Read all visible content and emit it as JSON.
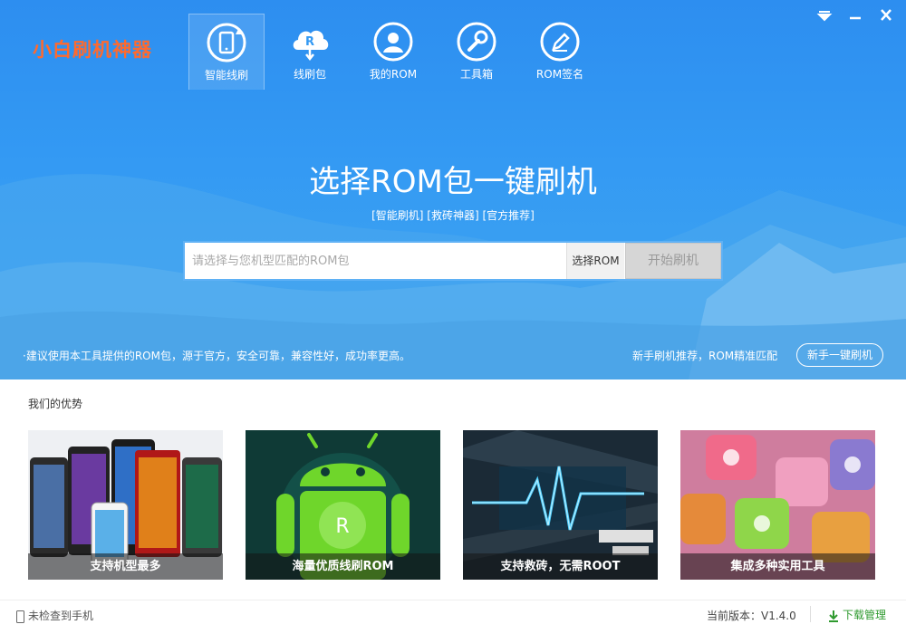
{
  "app": {
    "logo": "小白刷机神器"
  },
  "nav": {
    "tabs": [
      {
        "label": "智能线刷",
        "icon": "phone-refresh-icon",
        "active": true
      },
      {
        "label": "线刷包",
        "icon": "cloud-download-icon",
        "active": false
      },
      {
        "label": "我的ROM",
        "icon": "user-icon",
        "active": false
      },
      {
        "label": "工具箱",
        "icon": "wrench-icon",
        "active": false
      },
      {
        "label": "ROM签名",
        "icon": "pen-icon",
        "active": false
      }
    ]
  },
  "window": {
    "buttons": [
      "dropdown-icon",
      "minimize-icon",
      "close-icon"
    ]
  },
  "hero": {
    "headline": "选择ROM包一键刷机",
    "subtags": "[智能刷机] [救砖神器] [官方推荐]",
    "search": {
      "placeholder": "请选择与您机型匹配的ROM包",
      "value": ""
    },
    "select_button": "选择ROM",
    "start_button": "开始刷机",
    "tip": "·建议使用本工具提供的ROM包，源于官方，安全可靠，兼容性好，成功率更高。",
    "recommend_text": "新手刷机推荐，ROM精准匹配",
    "newbie_button": "新手一键刷机"
  },
  "advantages": {
    "title": "我们的优势",
    "cards": [
      {
        "caption": "支持机型最多"
      },
      {
        "caption": "海量优质线刷ROM"
      },
      {
        "caption": "支持救砖，无需ROOT"
      },
      {
        "caption": "集成多种实用工具"
      }
    ]
  },
  "status": {
    "phone": "未检查到手机",
    "version": "当前版本：V1.4.0",
    "download": "下载管理"
  },
  "colors": {
    "brand_orange": "#ff6a2e",
    "hero_blue": "#3399f3",
    "download_green": "#2f9a2f"
  }
}
